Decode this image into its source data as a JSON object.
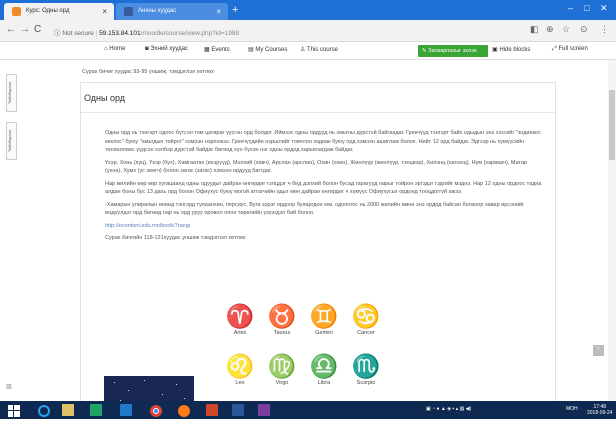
{
  "browser": {
    "tabs": [
      {
        "label": "Курс: Одны орд",
        "close": "×"
      },
      {
        "label": "Анхны хуудас",
        "close": "×"
      }
    ],
    "new_tab": "+",
    "window_controls": {
      "minimize": "–",
      "maximize": "□",
      "close": "✕"
    },
    "nav": {
      "back": "←",
      "forward": "→",
      "reload": "C",
      "info": "ⓘ"
    },
    "url": {
      "security": "Not secure",
      "host": "59.153.84.101",
      "path": "/moodle/course/view.php?id=1988"
    },
    "tools": {
      "cast": "◧",
      "zoom": "⊕",
      "star": "☆",
      "account": "⊙",
      "menu": "⋮"
    }
  },
  "moodle_nav": {
    "home": "Home",
    "dashboard": "Эхний хуудас",
    "events": "Events",
    "my_courses": "My Courses",
    "this_course": "This course",
    "edit_button": "Засварлахыг эхлэх",
    "hide_blocks": "Hide blocks",
    "full_screen": "Full screen"
  },
  "side_tabs": [
    "Тайлбарлах",
    "Тайлбарлах"
  ],
  "content": {
    "top_note": "Сурах бичиг хуудас 93-95 уншиж, тэмдэглэл хөтлөх",
    "title": "Одны орд",
    "paragraphs": [
      "Одны орд нь тэнгэрт одоос бүтсэн том цагираг үүсгэн орд болдог. Иймээс одны ордууд нь эмьтны дүрстэй байгаадаг. Грекчүүд тэнгэрт байх одыдын энэ хэсгийг \"зодиакос киклос\" буюу \"амьтдын тойрог\" хэмээн нэрлэжээ. Грекчүүдийн нэршлийг товчлон зодиак буюу орд хэмээн ашиглаж болох. Нийт 12 орд байдаг. Эдгээр нь хумүүсийн төсөөллөөс үүдсэн хэлбэр дүрстэй байдаг бөгөөд хүн бүхэн нэг одны ордод харьялагдаж байдаг.",
      "Үхэр, Хонь (хуц), Үхэр (бух), Хамгаатах (ихэрүүд), Мэлхий (хавч), Арслан (арслан), Охин (охин), Жинлүүр (жинлүүр, тэнцвэр), Хилэнц (хилэнц), Нум (харваач), Матар (ухна), Хумх (ус зөөгч) болон загас (загас) хэмээн ордууд багтдаг.",
      "Нар жилийн өөр өөр хугацаанд одны одуудыг дайран өнгөрдөг гэлцдэг ч бид дэлхий болон бусад гарагууд нарыг тойрон эргэдэг гэдгийг мэднэ. Нар 12 одны ордоос тадна алдан боны бус 13 дахь орд болон Офиухус буюу могой атгагчийн одыг мөн дайран өнгөрдөг ч хүмүүс Офиухусыг ордонд тооцдоггүй ажээ.",
      "-Хамарын улиралын өнөөд тэнгэрд туяаанхин, персиус, Вуга зэрэг ордоор буяаргдон юм. одоогоос нь 2000 жилийн өмнө энэ ордод байсан болзоор хавар ирсэнийг мэдүүлдэг орд бөгөөд нар нь орд уруу оровол олон төрөлийн үзүэгдэл бий болно."
    ],
    "link": "http://econtent.edu.mn/book/7rangi",
    "assignment": "Сурах бичгийн 118-121хуудас уншиж тэмдэглэл хөтлөх",
    "zodiac": [
      {
        "glyph": "♈",
        "name": "Aries"
      },
      {
        "glyph": "♉",
        "name": "Taurus"
      },
      {
        "glyph": "♊",
        "name": "Gemini"
      },
      {
        "glyph": "♋",
        "name": "Cancer"
      },
      {
        "glyph": "♌",
        "name": "Leo"
      },
      {
        "glyph": "♍",
        "name": "Virgo"
      },
      {
        "glyph": "♎",
        "name": "Libra"
      },
      {
        "glyph": "♏",
        "name": "Scorpio"
      }
    ]
  },
  "taskbar": {
    "lang": "MOH",
    "time": "17:48",
    "date": "2018-09-24"
  },
  "colors": {
    "tabbar": "#1e6fd6",
    "edit_button": "#3aa535",
    "taskbar": "#0f2a52",
    "link": "#5a7bbd"
  }
}
